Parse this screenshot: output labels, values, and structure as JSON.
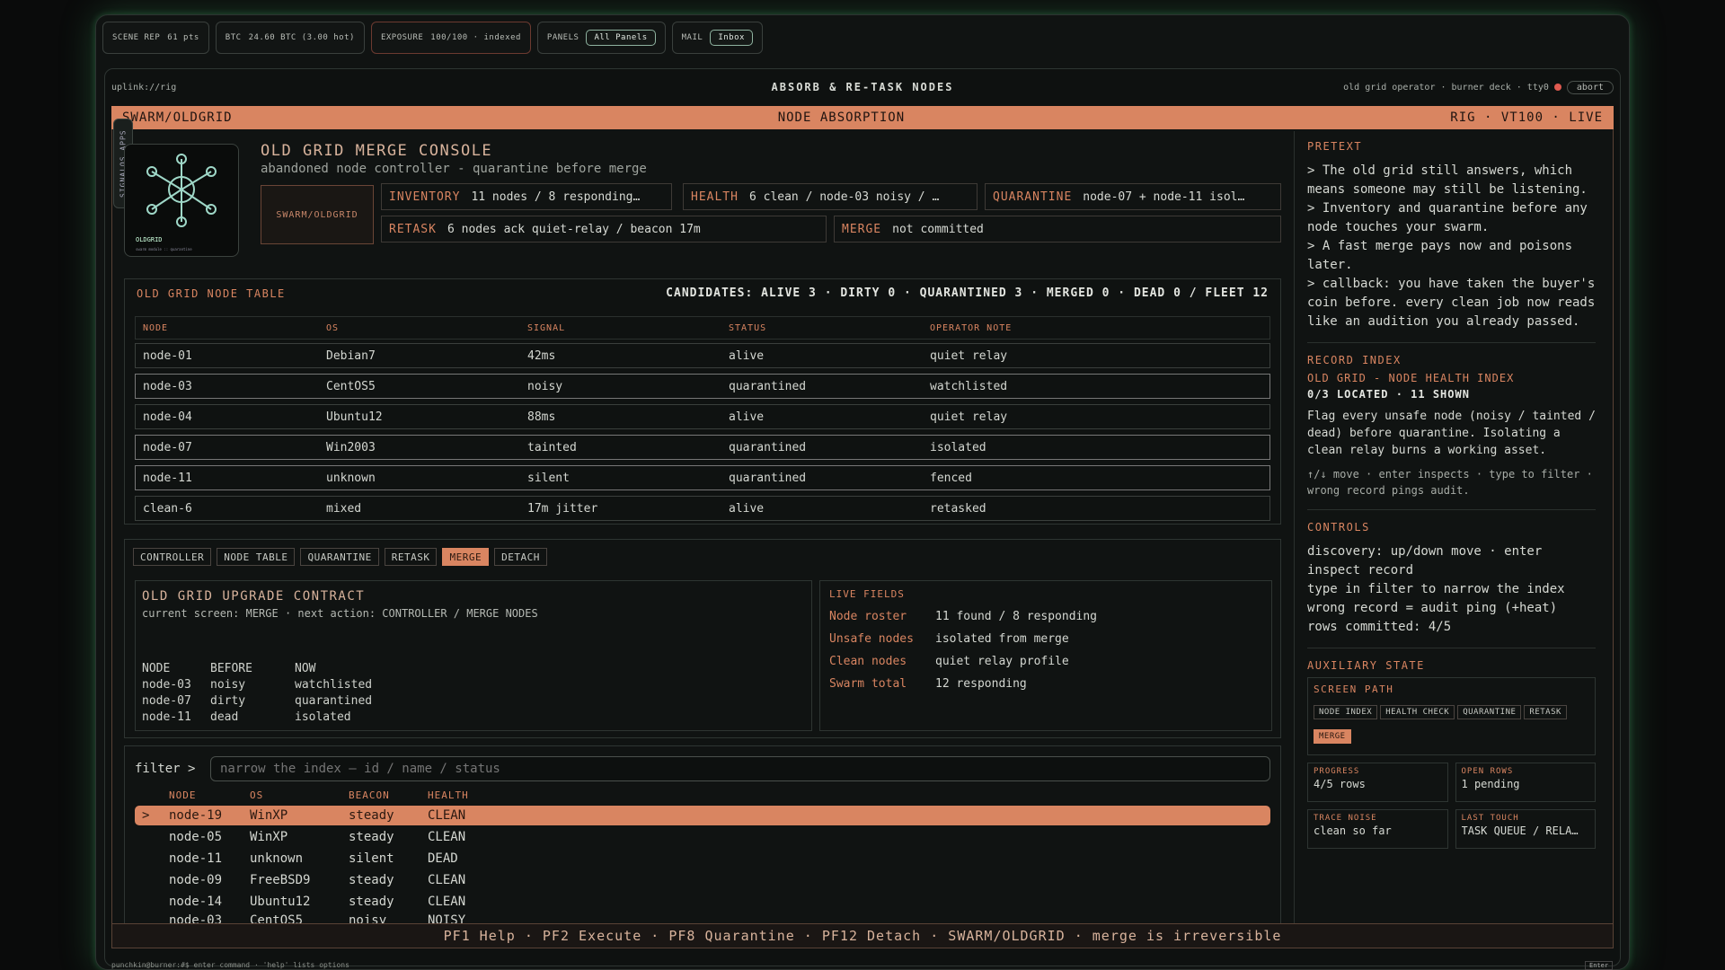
{
  "top_chips": [
    {
      "label": "SCENE REP",
      "value": "61 pts"
    },
    {
      "label": "BTC",
      "value": "24.60 BTC (3.00 hot)"
    },
    {
      "label": "EXPOSURE",
      "value": "100/100 · indexed"
    },
    {
      "label": "PANELS",
      "button": "All Panels"
    },
    {
      "label": "MAIL",
      "button": "Inbox"
    }
  ],
  "window": {
    "path": "uplink://rig",
    "title": "ABSORB & RE-TASK NODES",
    "right": "old grid operator · burner deck · tty0",
    "abort": "abort"
  },
  "banner": {
    "left": "SWARM/OLDGRID",
    "center": "NODE ABSORPTION",
    "right": "RIG · VT100 · LIVE"
  },
  "side_tab": "SIGNALOS APPS",
  "logo": {
    "name": "OLDGRID",
    "sub": "swarm module :: quarantine"
  },
  "console": {
    "title": "OLD GRID MERGE CONSOLE",
    "subtitle": "abandoned node controller - quarantine before merge",
    "tag": "SWARM/OLDGRID",
    "fields": [
      {
        "k": "INVENTORY",
        "v": "11 nodes / 8 responding…"
      },
      {
        "k": "HEALTH",
        "v": "6 clean / node-03 noisy / …"
      },
      {
        "k": "QUARANTINE",
        "v": "node-07 + node-11 isol…"
      },
      {
        "k": "RETASK",
        "v": "6 nodes ack quiet-relay / beacon 17m"
      },
      {
        "k": "MERGE",
        "v": "not committed"
      }
    ]
  },
  "node_table": {
    "title": "OLD GRID NODE TABLE",
    "candidates": "CANDIDATES: ALIVE 3 · DIRTY 0 · QUARANTINED 3 · MERGED 0 · DEAD 0 / FLEET 12",
    "columns": [
      "NODE",
      "OS",
      "SIGNAL",
      "STATUS",
      "OPERATOR NOTE"
    ],
    "rows": [
      [
        "node-01",
        "Debian7",
        "42ms",
        "alive",
        "quiet relay"
      ],
      [
        "node-03",
        "CentOS5",
        "noisy",
        "quarantined",
        "watchlisted"
      ],
      [
        "node-04",
        "Ubuntu12",
        "88ms",
        "alive",
        "quiet relay"
      ],
      [
        "node-07",
        "Win2003",
        "tainted",
        "quarantined",
        "isolated"
      ],
      [
        "node-11",
        "unknown",
        "silent",
        "quarantined",
        "fenced"
      ],
      [
        "clean-6",
        "mixed",
        "17m jitter",
        "alive",
        "retasked"
      ]
    ]
  },
  "tabs": [
    "CONTROLLER",
    "NODE TABLE",
    "QUARANTINE",
    "RETASK",
    "MERGE",
    "DETACH"
  ],
  "active_tab": "MERGE",
  "contract": {
    "title": "OLD GRID UPGRADE CONTRACT",
    "line": "current screen: MERGE · next action: CONTROLLER / MERGE NODES",
    "columns": [
      "NODE",
      "BEFORE",
      "NOW"
    ],
    "rows": [
      [
        "node-03",
        "noisy",
        "watchlisted"
      ],
      [
        "node-07",
        "dirty",
        "quarantined"
      ],
      [
        "node-11",
        "dead",
        "isolated"
      ]
    ]
  },
  "live_fields": {
    "title": "LIVE FIELDS",
    "rows": [
      {
        "k": "Node roster",
        "v": "11 found / 8 responding"
      },
      {
        "k": "Unsafe nodes",
        "v": "isolated from merge"
      },
      {
        "k": "Clean nodes",
        "v": "quiet relay profile"
      },
      {
        "k": "Swarm total",
        "v": "12 responding"
      }
    ]
  },
  "filter": {
    "label": "filter >",
    "placeholder": "narrow the index — id / name / status",
    "columns": [
      "NODE",
      "OS",
      "BEACON",
      "HEALTH"
    ],
    "rows": [
      [
        "node-19",
        "WinXP",
        "steady",
        "CLEAN"
      ],
      [
        "node-05",
        "WinXP",
        "steady",
        "CLEAN"
      ],
      [
        "node-11",
        "unknown",
        "silent",
        "DEAD"
      ],
      [
        "node-09",
        "FreeBSD9",
        "steady",
        "CLEAN"
      ],
      [
        "node-14",
        "Ubuntu12",
        "steady",
        "CLEAN"
      ],
      [
        "node-03",
        "CentOS5",
        "noisy",
        "NOISY"
      ]
    ],
    "selected_marker": ">"
  },
  "footer": "PF1 Help · PF2 Execute · PF8 Quarantine · PF12 Detach · SWARM/OLDGRID · merge is irreversible",
  "prompt": "punchkin@burner:#$  enter command · 'help' lists options",
  "enter": "Enter",
  "sidebar": {
    "pretext_title": "PRETEXT",
    "pretext": [
      "> The old grid still answers, which means someone may still be listening.",
      "> Inventory and quarantine before any node touches your swarm.",
      "> A fast merge pays now and poisons later.",
      "> callback: you have taken the buyer's coin before. every clean job now reads like an audition you already passed."
    ],
    "record_title": "RECORD INDEX",
    "record_name": "OLD GRID - NODE HEALTH INDEX",
    "record_count": "0/3 LOCATED · 11 SHOWN",
    "record_desc": "Flag every unsafe node (noisy / tainted / dead) before quarantine. Isolating a clean relay burns a working asset.",
    "record_hint": "↑/↓ move · enter inspects · type to filter · wrong record pings audit.",
    "controls_title": "CONTROLS",
    "controls": [
      "discovery: up/down move · enter inspect record",
      "type in filter to narrow the index",
      "wrong record = audit ping (+heat)",
      "rows committed: 4/5"
    ],
    "aux_title": "AUXILIARY STATE",
    "screen_path_title": "SCREEN PATH",
    "screen_path": [
      "NODE INDEX",
      "HEALTH CHECK",
      "QUARANTINE",
      "RETASK",
      "MERGE"
    ],
    "active_path": "MERGE",
    "cells": [
      {
        "k": "PROGRESS",
        "v": "4/5 rows"
      },
      {
        "k": "OPEN ROWS",
        "v": "1 pending"
      },
      {
        "k": "TRACE NOISE",
        "v": "clean so far"
      },
      {
        "k": "LAST TOUCH",
        "v": "TASK QUEUE / RELA…"
      }
    ]
  },
  "colors": {
    "accent": "#d98561",
    "glow": "#50c878",
    "bg": "#101312"
  }
}
